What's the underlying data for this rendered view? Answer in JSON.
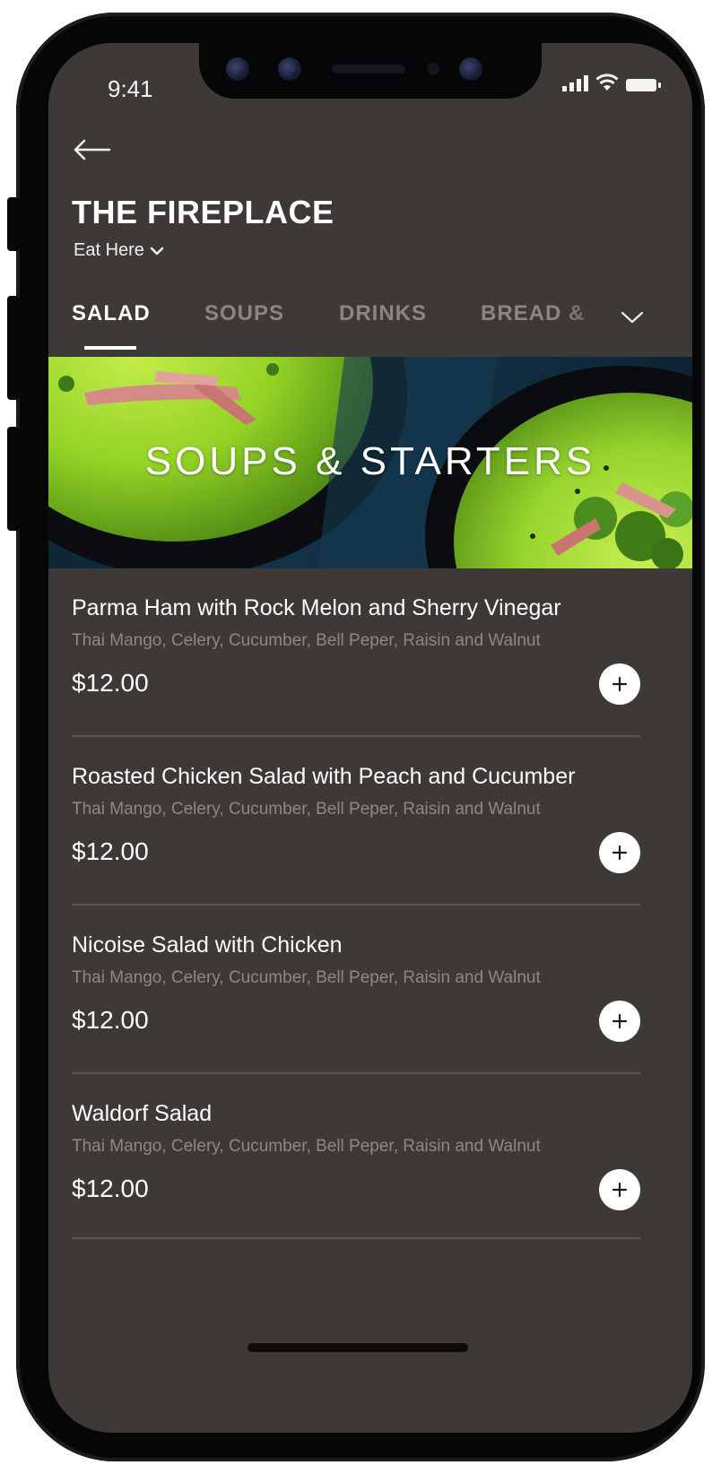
{
  "status_bar": {
    "time": "9:41"
  },
  "header": {
    "venue_name": "THE FIREPLACE",
    "dining_mode": "Eat Here"
  },
  "tabs": [
    {
      "label": "SALAD",
      "active": true
    },
    {
      "label": "SOUPS",
      "active": false
    },
    {
      "label": "DRINKS",
      "active": false
    },
    {
      "label": "BREAD & ",
      "active": false
    }
  ],
  "hero": {
    "title": "SOUPS & STARTERS"
  },
  "menu_items": [
    {
      "name": "Parma Ham with Rock Melon and Sherry Vinegar",
      "description": "Thai Mango, Celery, Cucumber, Bell Peper, Raisin and Walnut",
      "price": "$12.00"
    },
    {
      "name": "Roasted Chicken Salad with Peach and Cucumber",
      "description": "Thai Mango, Celery, Cucumber, Bell Peper, Raisin and Walnut",
      "price": "$12.00"
    },
    {
      "name": "Nicoise Salad with Chicken",
      "description": "Thai Mango, Celery, Cucumber, Bell Peper, Raisin and Walnut",
      "price": "$12.00"
    },
    {
      "name": "Waldorf Salad",
      "description": "Thai Mango, Celery, Cucumber, Bell Peper, Raisin and Walnut",
      "price": "$12.00"
    }
  ],
  "colors": {
    "screen_background": "#3c3936",
    "text_primary": "#ffffff",
    "text_muted": "#8d8883",
    "tab_inactive": "#8b8681",
    "divider": "#5a5651"
  },
  "icons": {
    "back": "arrow-left-icon",
    "mode_dropdown": "chevron-down-icon",
    "tabs_more": "chevron-down-icon",
    "add": "plus-icon"
  }
}
